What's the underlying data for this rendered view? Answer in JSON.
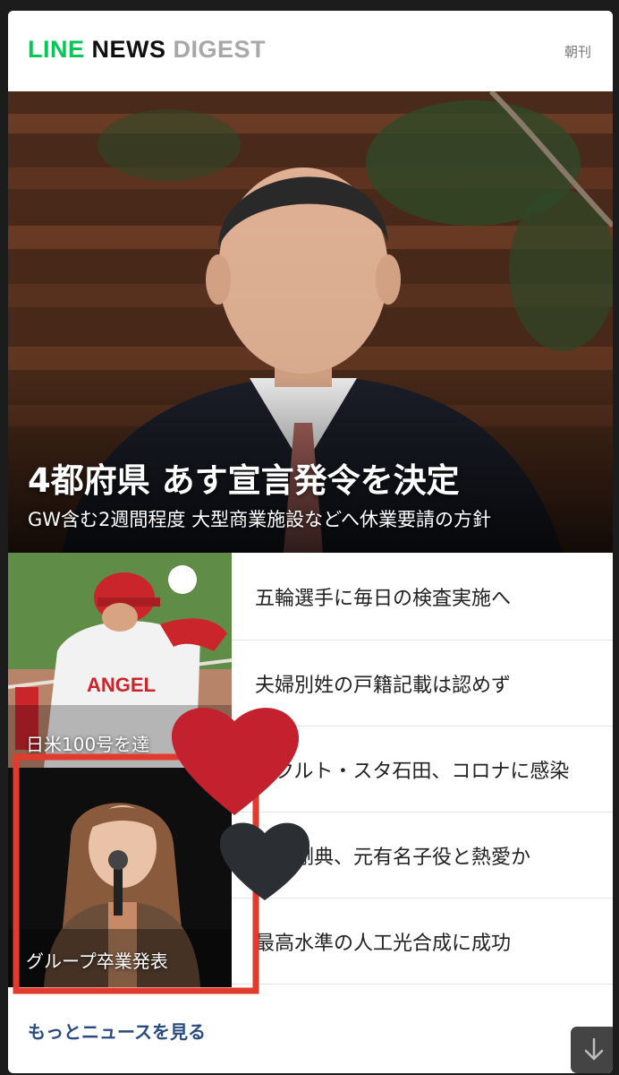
{
  "header": {
    "logo_line": "LINE",
    "logo_news": "NEWS",
    "logo_digest": "DIGEST",
    "edition": "朝刊"
  },
  "hero": {
    "title": "4都府県 あす宣言発令を決定",
    "subtitle": "GW含む2週間程度 大型商業施設などへ休業要請の方針"
  },
  "thumbs": [
    {
      "caption": "日米100号を達"
    },
    {
      "caption": "グループ卒業発表"
    }
  ],
  "news": [
    {
      "title": "五輪選手に毎日の検査実施へ"
    },
    {
      "title": "夫婦別姓の戸籍記載は認めず"
    },
    {
      "title": "ヤクルト・スタ石田、コロナに感染"
    },
    {
      "title": "岩田剛典、元有名子役と熱愛か"
    },
    {
      "title": "最高水準の人工光合成に成功"
    }
  ],
  "footer": {
    "more_label": "もっとニュースを見る",
    "scroll_icon": "arrow-down-icon"
  },
  "colors": {
    "brand_green": "#06c755",
    "link_blue": "#2a4b80",
    "highlight_red": "#e23a2c",
    "heart_red": "#c4212f",
    "heart_dark": "#2b2f33"
  }
}
